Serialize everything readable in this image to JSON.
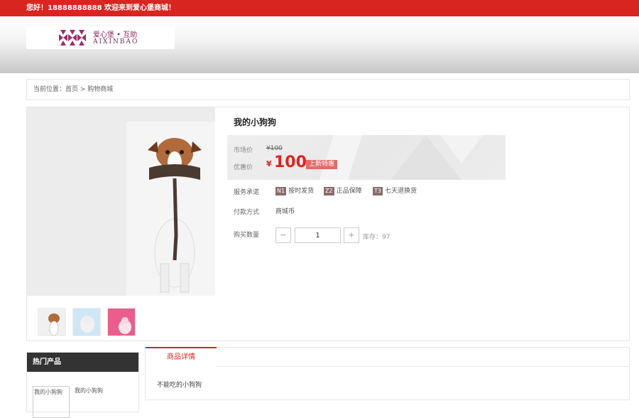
{
  "topbar": {
    "welcome": "您好！18888888888 欢迎来到爱心堡商城！"
  },
  "header": {
    "logo": {
      "cn": "爱心堡 • 互助",
      "en": "AIXINBAO",
      "color": "#8b2a5f"
    }
  },
  "breadcrumb": {
    "text": "当前位置：首页 > 购物商城"
  },
  "product": {
    "title": "我的小狗狗",
    "market_price_label": "市场价",
    "market_price": "¥100",
    "promo_price_label": "优惠价",
    "currency": "¥",
    "promo_price": "100",
    "promo_tag": "上新特惠",
    "service_label": "服务承诺",
    "services": [
      {
        "badge": "N1",
        "text": "按时发货"
      },
      {
        "badge": "Z2",
        "text": "正品保障"
      },
      {
        "badge": "T3",
        "text": "七天退换货"
      }
    ],
    "payment_label": "付款方式",
    "payment": "商城币",
    "qty_label": "购买数量",
    "qty_minus": "−",
    "qty_value": "1",
    "qty_plus": "+",
    "stock": "库存：97"
  },
  "hot": {
    "title": "热门产品",
    "items": [
      {
        "img_alt": "我的小狗狗",
        "name": "我的小狗狗"
      }
    ]
  },
  "detail": {
    "tab_label": "商品详情",
    "description": "不能吃的小狗狗"
  },
  "colors": {
    "accent": "#d9251f",
    "dark": "#333333"
  }
}
